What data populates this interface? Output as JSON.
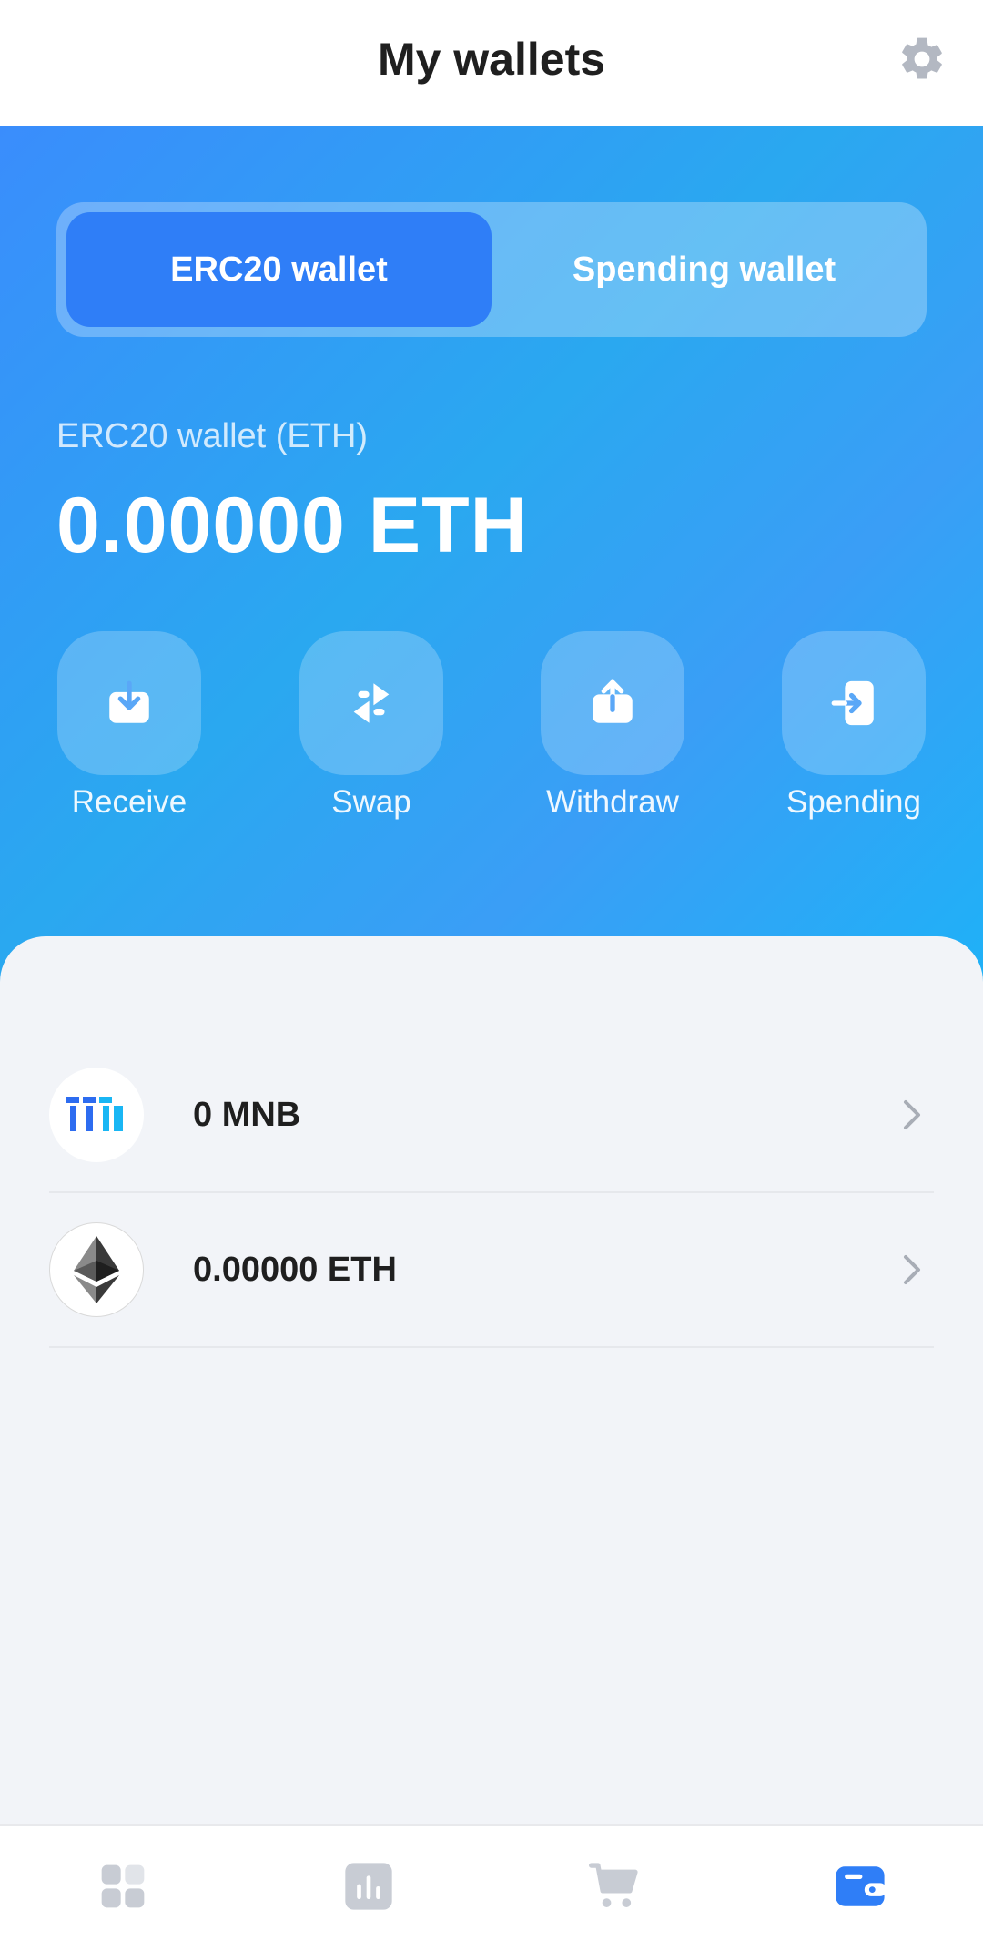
{
  "header": {
    "title": "My wallets",
    "settings_icon": "gear-icon"
  },
  "tabs": [
    {
      "label": "ERC20 wallet",
      "active": true
    },
    {
      "label": "Spending wallet",
      "active": false
    }
  ],
  "wallet": {
    "label": "ERC20 wallet (ETH)",
    "balance": "0.00000 ETH"
  },
  "actions": [
    {
      "label": "Receive",
      "icon": "receive-icon"
    },
    {
      "label": "Swap",
      "icon": "swap-icon"
    },
    {
      "label": "Withdraw",
      "icon": "withdraw-icon"
    },
    {
      "label": "Spending",
      "icon": "transfer-in-icon"
    }
  ],
  "assets": [
    {
      "amount": "0 MNB",
      "icon": "mnb-logo-icon"
    },
    {
      "amount": "0.00000 ETH",
      "icon": "ethereum-logo-icon"
    }
  ],
  "nav": [
    {
      "icon": "grid-icon",
      "active": false
    },
    {
      "icon": "chart-icon",
      "active": false
    },
    {
      "icon": "cart-icon",
      "active": false
    },
    {
      "icon": "wallet-icon",
      "active": true
    }
  ],
  "colors": {
    "accent": "#2f7ef7",
    "nav_inactive": "#c8ccd4",
    "text_dark": "#1f1f1f"
  }
}
